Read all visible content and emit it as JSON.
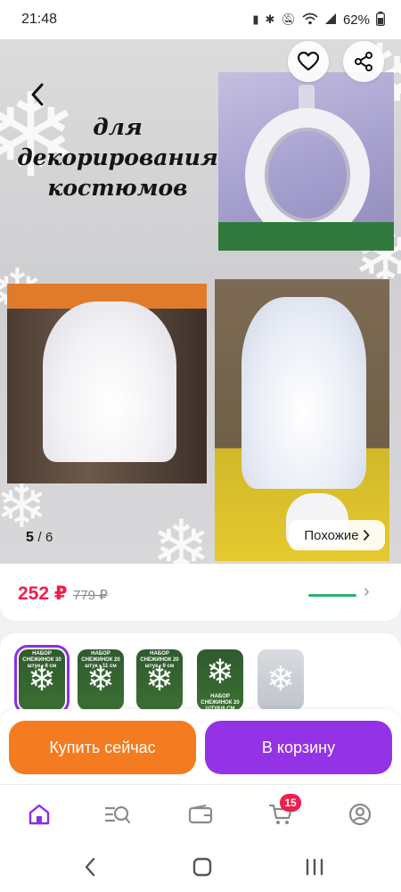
{
  "status_bar": {
    "time": "21:48",
    "battery": "62%",
    "icons": [
      "battery-saver-icon",
      "bluetooth-icon",
      "mute-icon",
      "wifi-icon",
      "signal-icon",
      "battery-icon"
    ]
  },
  "gallery": {
    "title_line1": "для",
    "title_line2": "декорирования",
    "title_line3": "костюмов",
    "current_index": "5",
    "total": "6",
    "counter_separator": "/",
    "similar_label": "Похожие"
  },
  "price": {
    "current": "252 ₽",
    "old": "779 ₽"
  },
  "variants": [
    {
      "label": "НАБОР СНЕЖИНОК 30 штук • 6 см",
      "selected": true
    },
    {
      "label": "НАБОР СНЕЖИНОК 20 штук • 11 см",
      "selected": false
    },
    {
      "label": "НАБОР СНЕЖИНОК 20 штук • 9 см",
      "selected": false
    },
    {
      "label": "НАБОР СНЕЖИНОК 20 ШТУК/6 СМ",
      "selected": false
    },
    {
      "label": "",
      "selected": false
    }
  ],
  "actions": {
    "buy_now": "Купить сейчас",
    "add_to_cart": "В корзину"
  },
  "bottom_nav": {
    "cart_badge": "15"
  },
  "colors": {
    "accent_purple": "#9433e6",
    "accent_orange": "#f47b20",
    "price_red": "#f01d4c"
  }
}
